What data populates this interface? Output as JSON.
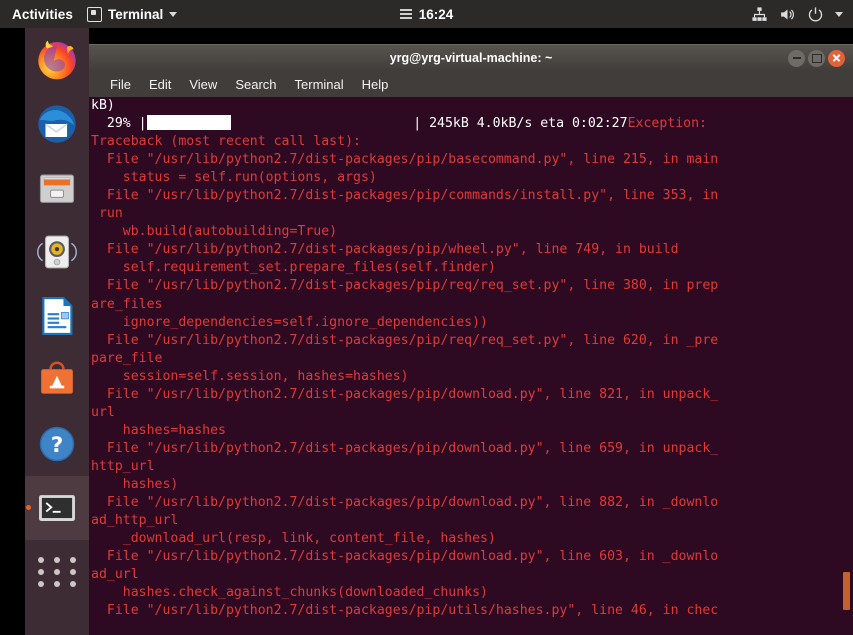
{
  "topbar": {
    "activities": "Activities",
    "app_name": "Terminal",
    "clock": "16:24",
    "icons": [
      "app-window-icon",
      "chevron-down-icon",
      "calendar-icon",
      "network-icon",
      "volume-icon",
      "power-icon",
      "chevron-down-icon"
    ]
  },
  "dock": {
    "items": [
      {
        "name": "firefox",
        "label": "Firefox Web Browser",
        "active": false
      },
      {
        "name": "thunderbird",
        "label": "Thunderbird Mail",
        "active": false
      },
      {
        "name": "files",
        "label": "Files",
        "active": false
      },
      {
        "name": "rhythmbox",
        "label": "Rhythmbox",
        "active": false
      },
      {
        "name": "libreoffice-writer",
        "label": "LibreOffice Writer",
        "active": false
      },
      {
        "name": "ubuntu-software",
        "label": "Ubuntu Software",
        "active": false
      },
      {
        "name": "help",
        "label": "Help",
        "active": false
      },
      {
        "name": "terminal",
        "label": "Terminal",
        "active": true
      },
      {
        "name": "show-applications",
        "label": "Show Applications",
        "active": false
      }
    ]
  },
  "window": {
    "title": "yrg@yrg-virtual-machine: ~",
    "menu": [
      "File",
      "Edit",
      "View",
      "Search",
      "Terminal",
      "Help"
    ],
    "controls": {
      "minimize": "minimize-button",
      "maximize": "maximize-button",
      "close": "close-button"
    }
  },
  "terminal": {
    "background_color": "#2d0922",
    "error_color": "#e03a3a",
    "text_color": "#ffffff",
    "scrollbar_thumb_color": "#c4622f",
    "progress": {
      "percent": "29%",
      "percent_value": 29,
      "bar_fill_char": "block",
      "left_bracket": "|",
      "right_bracket": "|",
      "downloaded": "245kB",
      "rate": "4.0kB/s",
      "eta": "eta 0:02:27",
      "stats_line": " | 245kB 4.0kB/s eta 0:02:27",
      "trailing_error": "Exception:"
    },
    "lines": [
      {
        "text": "kB)",
        "color": "white"
      },
      {
        "text": "  29% |",
        "color": "white",
        "kind": "progress"
      },
      {
        "text": "Traceback (most recent call last):",
        "color": "red"
      },
      {
        "text": "  File \"/usr/lib/python2.7/dist-packages/pip/basecommand.py\", line 215, in main",
        "color": "red"
      },
      {
        "text": "    status = self.run(options, args)",
        "color": "red"
      },
      {
        "text": "  File \"/usr/lib/python2.7/dist-packages/pip/commands/install.py\", line 353, in",
        "color": "red"
      },
      {
        "text": " run",
        "color": "red"
      },
      {
        "text": "    wb.build(autobuilding=True)",
        "color": "red"
      },
      {
        "text": "  File \"/usr/lib/python2.7/dist-packages/pip/wheel.py\", line 749, in build",
        "color": "red"
      },
      {
        "text": "    self.requirement_set.prepare_files(self.finder)",
        "color": "red"
      },
      {
        "text": "  File \"/usr/lib/python2.7/dist-packages/pip/req/req_set.py\", line 380, in prep",
        "color": "red"
      },
      {
        "text": "are_files",
        "color": "red"
      },
      {
        "text": "    ignore_dependencies=self.ignore_dependencies))",
        "color": "red"
      },
      {
        "text": "  File \"/usr/lib/python2.7/dist-packages/pip/req/req_set.py\", line 620, in _pre",
        "color": "red"
      },
      {
        "text": "pare_file",
        "color": "red"
      },
      {
        "text": "    session=self.session, hashes=hashes)",
        "color": "red"
      },
      {
        "text": "  File \"/usr/lib/python2.7/dist-packages/pip/download.py\", line 821, in unpack_",
        "color": "red"
      },
      {
        "text": "url",
        "color": "red"
      },
      {
        "text": "    hashes=hashes",
        "color": "red"
      },
      {
        "text": "  File \"/usr/lib/python2.7/dist-packages/pip/download.py\", line 659, in unpack_",
        "color": "red"
      },
      {
        "text": "http_url",
        "color": "red"
      },
      {
        "text": "    hashes)",
        "color": "red"
      },
      {
        "text": "  File \"/usr/lib/python2.7/dist-packages/pip/download.py\", line 882, in _downlo",
        "color": "red"
      },
      {
        "text": "ad_http_url",
        "color": "red"
      },
      {
        "text": "    _download_url(resp, link, content_file, hashes)",
        "color": "red"
      },
      {
        "text": "  File \"/usr/lib/python2.7/dist-packages/pip/download.py\", line 603, in _downlo",
        "color": "red"
      },
      {
        "text": "ad_url",
        "color": "red"
      },
      {
        "text": "    hashes.check_against_chunks(downloaded_chunks)",
        "color": "red"
      },
      {
        "text": "  File \"/usr/lib/python2.7/dist-packages/pip/utils/hashes.py\", line 46, in chec",
        "color": "red"
      }
    ]
  }
}
